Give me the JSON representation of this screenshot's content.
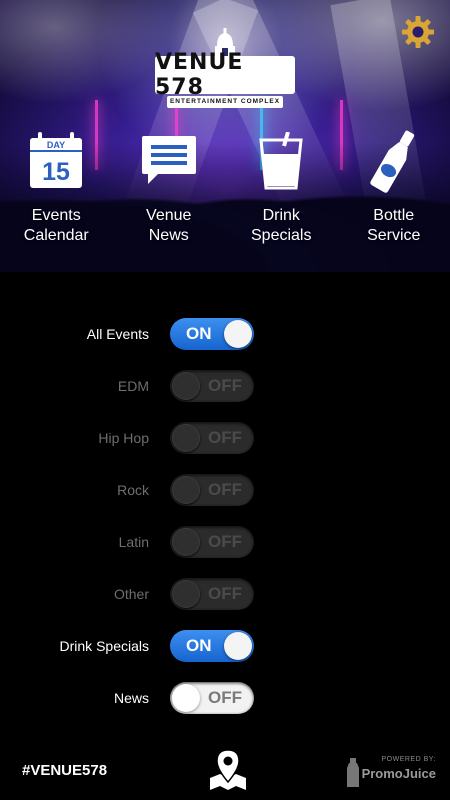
{
  "header": {
    "logo_title": "VENUE 578",
    "logo_subtitle": "ENTERTAINMENT COMPLEX",
    "settings_icon": "gear-icon"
  },
  "nav": {
    "items": [
      {
        "label": "Events\nCalendar",
        "icon": "calendar-icon",
        "calendar_day_label": "DAY",
        "calendar_day_number": "15"
      },
      {
        "label": "Venue\nNews",
        "icon": "chat-bubble-icon"
      },
      {
        "label": "Drink\nSpecials",
        "icon": "glass-icon"
      },
      {
        "label": "Bottle\nService",
        "icon": "bottle-icon"
      }
    ]
  },
  "filters": [
    {
      "label": "All Events",
      "state": "ON",
      "on": true
    },
    {
      "label": "EDM",
      "state": "OFF",
      "on": false
    },
    {
      "label": "Hip Hop",
      "state": "OFF",
      "on": false
    },
    {
      "label": "Rock",
      "state": "OFF",
      "on": false
    },
    {
      "label": "Latin",
      "state": "OFF",
      "on": false
    },
    {
      "label": "Other",
      "state": "OFF",
      "on": false
    },
    {
      "label": "Drink Specials",
      "state": "ON",
      "on": true
    },
    {
      "label": "News",
      "state": "OFF",
      "on": false,
      "enabled_style": true
    }
  ],
  "footer": {
    "hashtag": "#VENUE578",
    "map_icon": "map-pin-icon",
    "powered_by": "POWERED BY:",
    "brand": "PromoJuice"
  },
  "colors": {
    "accent": "#1e74e0",
    "gear": "#d9a535"
  }
}
